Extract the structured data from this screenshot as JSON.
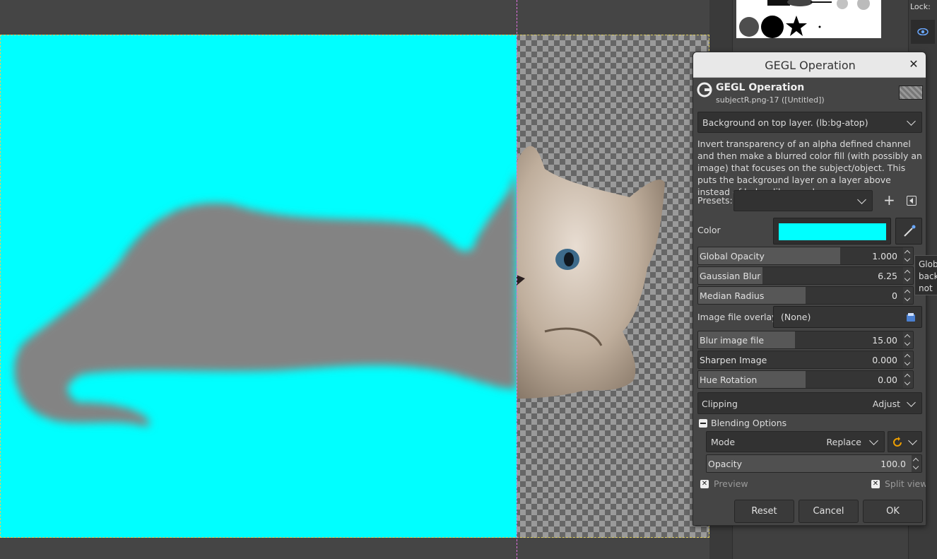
{
  "canvas": {
    "fill_color": "#00ffff"
  },
  "dock": {
    "lock_label": "Lock:"
  },
  "dialog": {
    "title": "GEGL Operation",
    "header_title": "GEGL Operation",
    "header_subtitle": "subjectR.png-17 ([Untitled])",
    "operation": "Background on top layer. (lb:bg-atop)",
    "description": "Invert transparency of an alpha defined channel and then make a blurred color fill (with possibly an image) that focuses on the subject/object. This puts the background layer on a layer above instead of below like usual.",
    "presets_label": "Presets:",
    "presets_value": "",
    "color_label": "Color",
    "color_value": "#00ffff",
    "global_opacity": {
      "label": "Global Opacity",
      "value": "1.000",
      "fraction": 0.66
    },
    "gaussian_blur": {
      "label": "Gaussian Blur",
      "value": "6.25",
      "fraction": 0.3
    },
    "median_radius": {
      "label": "Median Radius",
      "value": "0",
      "fraction": 0.5
    },
    "image_overlay_label": "Image file overlay",
    "image_overlay_value": "(None)",
    "blur_image": {
      "label": "Blur image file",
      "value": "15.00",
      "fraction": 0.45
    },
    "sharpen_image": {
      "label": "Sharpen Image",
      "value": "0.000",
      "fraction": 0.0
    },
    "hue_rotation": {
      "label": "Hue Rotation",
      "value": "0.00",
      "fraction": 0.5
    },
    "clipping_label": "Clipping",
    "clipping_value": "Adjust",
    "blending_label": "Blending Options",
    "mode_label": "Mode",
    "mode_value": "Replace",
    "opacity": {
      "label": "Opacity",
      "value": "100.0",
      "fraction": 1.0
    },
    "preview_label": "Preview",
    "split_view_label": "Split view",
    "reset_label": "Reset",
    "cancel_label": "Cancel",
    "ok_label": "OK"
  },
  "tooltip": {
    "lines": [
      "Glob",
      "back",
      "not w"
    ]
  }
}
